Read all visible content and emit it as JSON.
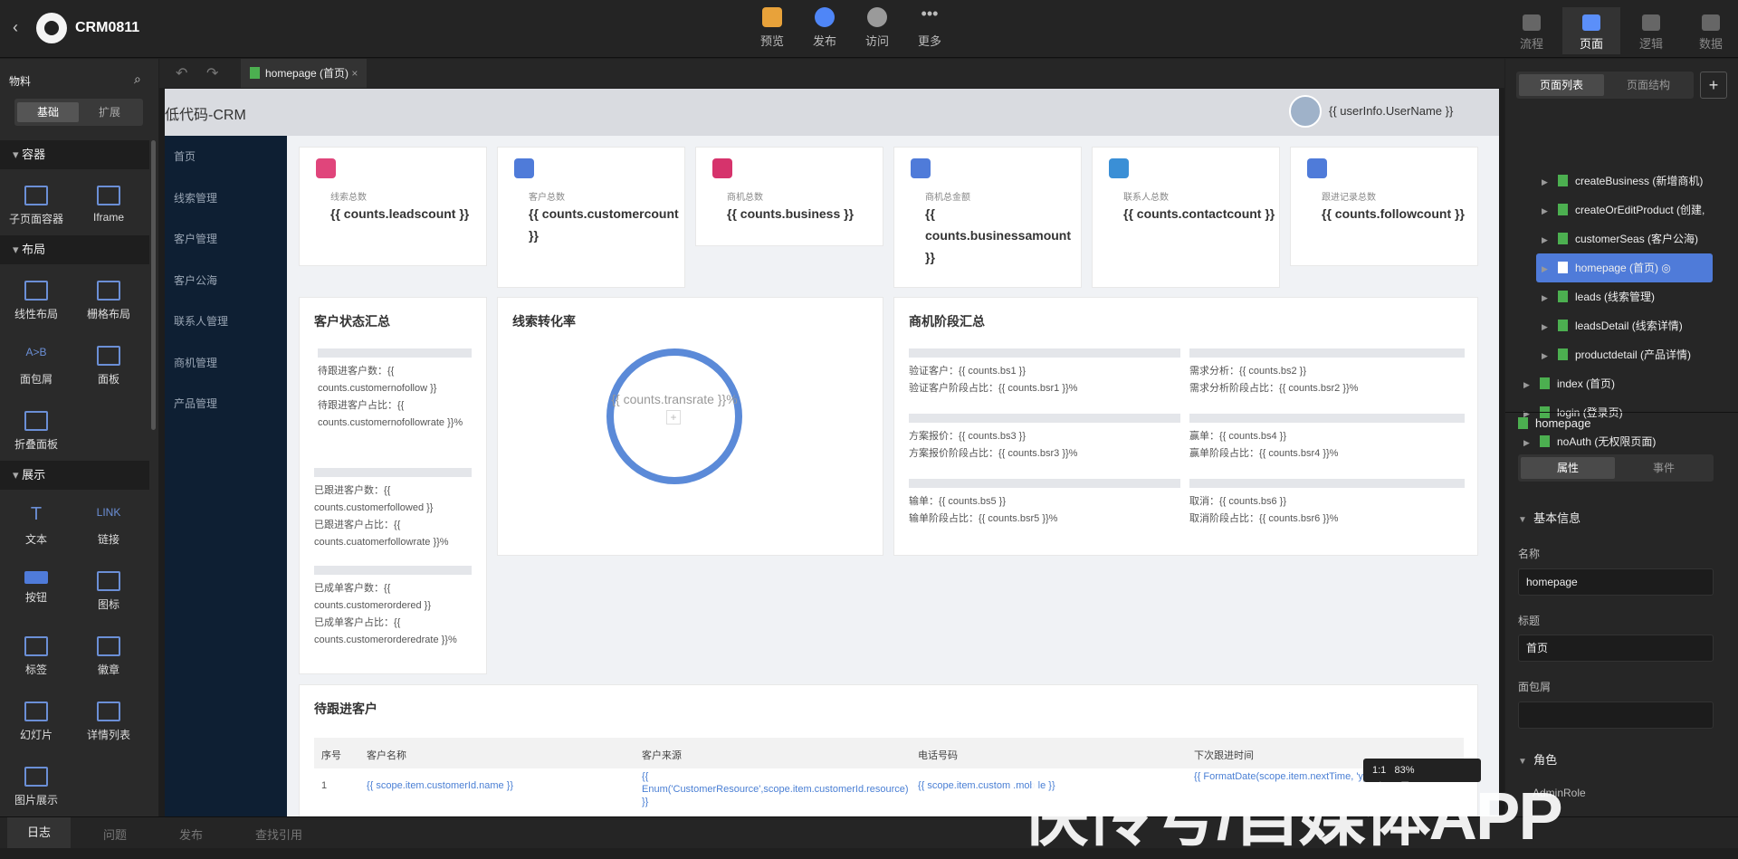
{
  "app": {
    "name": "CRM0811"
  },
  "toolbar": [
    {
      "label": "预览",
      "color": "#e8a23a"
    },
    {
      "label": "发布",
      "color": "#4f86f7"
    },
    {
      "label": "访问",
      "color": "#9a9a9a"
    },
    {
      "label": "更多",
      "color": "#9a9a9a"
    }
  ],
  "right_tabs": [
    "流程",
    "页面",
    "逻辑",
    "数据"
  ],
  "materials": {
    "title": "物料",
    "tab_basic": "基础",
    "tab_ext": "扩展",
    "categories": [
      "容器",
      "布局",
      "展示"
    ],
    "items": [
      "子页面容器",
      "Iframe",
      "线性布局",
      "栅格布局",
      "面包屑",
      "面板",
      "折叠面板",
      "文本",
      "链接",
      "按钮",
      "图标",
      "标签",
      "徽章",
      "幻灯片",
      "详情列表",
      "图片展示"
    ]
  },
  "bottom_tabs": [
    "日志",
    "问题",
    "发布",
    "查找引用"
  ],
  "editor": {
    "tab": "homepage (首页)"
  },
  "page": {
    "title": "低代码-CRM",
    "user": "{{ userInfo.UserName }}",
    "nav": [
      "首页",
      "线索管理",
      "客户管理",
      "客户公海",
      "联系人管理",
      "商机管理",
      "产品管理"
    ],
    "kpis": [
      {
        "label": "线索总数",
        "value": "{{ counts.leadscount }}",
        "color": "#e0457b"
      },
      {
        "label": "客户总数",
        "value": "{{ counts.customercount }}",
        "color": "#4f7bd9"
      },
      {
        "label": "商机总数",
        "value": "{{ counts.business }}",
        "color": "#d6336c"
      },
      {
        "label": "商机总金额",
        "value": "{{ counts.businessamount }}",
        "color": "#4f7bd9"
      },
      {
        "label": "联系人总数",
        "value": "{{ counts.contactcount }}",
        "color": "#3a8fd6"
      },
      {
        "label": "跟进记录总数",
        "value": "{{ counts.followcount }}",
        "color": "#4f7bd9"
      }
    ],
    "customer_status": {
      "title": "客户状态汇总",
      "lines": [
        "待跟进客户数：{{ counts.customernofollow }}",
        "待跟进客户占比：{{ counts.customernofollowrate }}%",
        "已跟进客户数：{{ counts.customerfollowed }}",
        "已跟进客户占比：{{ counts.cuatomerfollowrate }}%",
        "已成单客户数：{{ counts.customerordered }}",
        "已成单客户占比：{{ counts.customerorderedrate }}%"
      ]
    },
    "conversion": {
      "title": "线索转化率",
      "text": "{{ counts.transrate }}%",
      "plus": "+"
    },
    "stages": {
      "title": "商机阶段汇总",
      "lines": [
        "验证客户：{{ counts.bs1 }}",
        "验证客户阶段占比：{{ counts.bsr1 }}%",
        "需求分析：{{ counts.bs2 }}",
        "需求分析阶段占比：{{ counts.bsr2 }}%",
        "方案报价：{{ counts.bs3 }}",
        "方案报价阶段占比：{{ counts.bsr3 }}%",
        "赢单：{{ counts.bs4 }}",
        "赢单阶段占比：{{ counts.bsr4 }}%",
        "输单：{{ counts.bs5 }}",
        "输单阶段占比：{{ counts.bsr5 }}%",
        "取消：{{ counts.bs6 }}",
        "取消阶段占比：{{ counts.bsr6 }}%"
      ]
    },
    "table": {
      "title": "待跟进客户",
      "headers": [
        "序号",
        "客户名称",
        "客户来源",
        "电话号码",
        "下次跟进时间"
      ],
      "row": [
        "1",
        "{{ scope.item.customerId.name }}",
        "{{ Enum('CustomerResource',scope.item.customerId.resource) }}",
        "{{ scope.item.custom  .mob  le }}",
        "{{ FormatDate(scope.item.nextTime, 'yyyy-MM-dd') }}"
      ]
    }
  },
  "pages_panel": {
    "tab_list": "页面列表",
    "tab_struct": "页面结构",
    "add": "+",
    "nodes": [
      "createBusiness (新增商机)",
      "createOrEditProduct (创建,",
      "customerSeas (客户公海)",
      "homepage (首页)",
      "leads (线索管理)",
      "leadsDetail (线索详情)",
      "productdetail (产品详情)",
      "index (首页)",
      "login (登录页)",
      "noAuth (无权限页面)"
    ]
  },
  "props": {
    "name": "homepage",
    "tab_attr": "属性",
    "tab_event": "事件",
    "section": "基本信息",
    "name_label": "名称",
    "name_value": "homepage",
    "title_label": "标题",
    "title_value": "首页",
    "crumb_label": "面包屑",
    "role_label": "角色",
    "role_value": "AdminRole"
  },
  "zoom": {
    "ratio": "1:1",
    "percent": "83%"
  },
  "watermark": "快传号/自媒体APP"
}
